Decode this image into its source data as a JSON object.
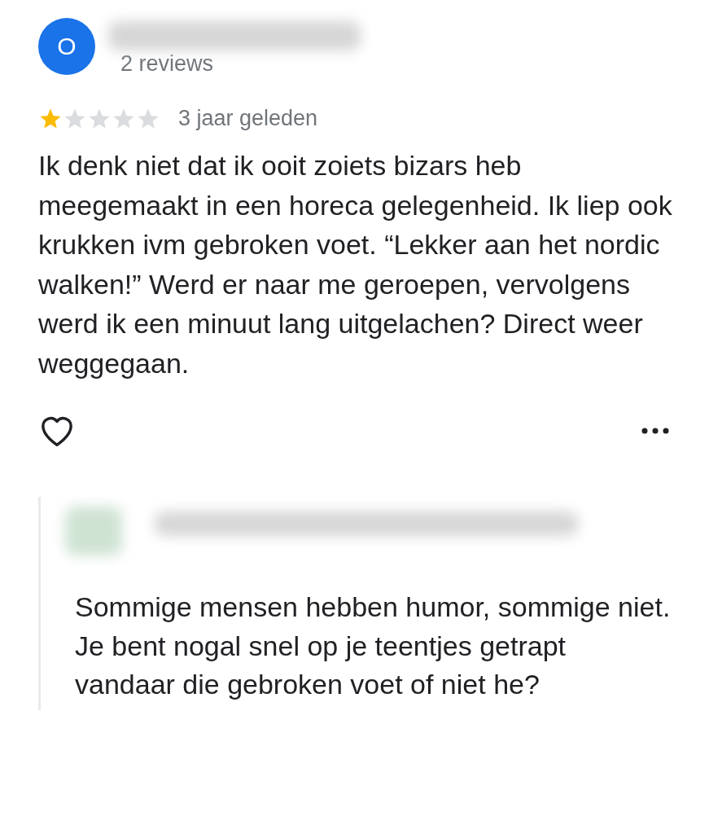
{
  "reviewer": {
    "avatar_letter": "O",
    "reviews": "2 reviews"
  },
  "review": {
    "stars": 1,
    "time": "3 jaar geleden",
    "text": "Ik denk niet dat ik ooit zoiets bizars heb meegemaakt in een horeca gelegenheid. Ik liep ook krukken ivm gebroken voet. “Lekker aan het nordic walken!” Werd er naar me geroepen, vervolgens werd ik een minuut lang uitgelachen? Direct weer weggegaan."
  },
  "reply": {
    "text": "Sommige mensen hebben humor, sommige niet. Je bent nogal snel op je teentjes getrapt vandaar die gebroken voet of niet he?"
  }
}
